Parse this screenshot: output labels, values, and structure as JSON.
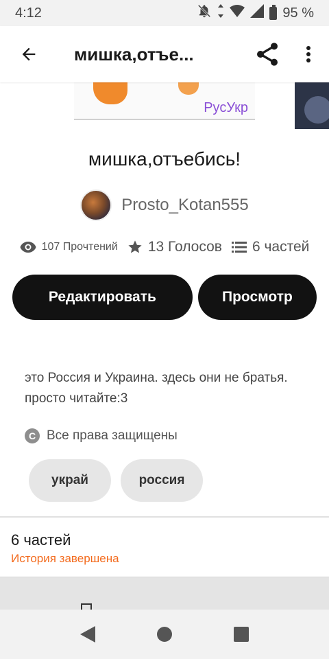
{
  "status_bar": {
    "time": "4:12",
    "battery": "95 %"
  },
  "app_bar": {
    "title": "мишка,отъе..."
  },
  "cover": {
    "text": "РусУкр"
  },
  "story": {
    "title": "мишка,отъебись!",
    "author": "Prosto_Kotan555",
    "reads": "107 Прочтений",
    "votes": "13 Голосов",
    "parts": "6 частей",
    "description": "это Россия и Украина. здесь они не братья. просто читайте:3",
    "copyright": "Все права защищены"
  },
  "actions": {
    "edit_label": "Редактировать",
    "view_label": "Просмотр"
  },
  "tags": [
    "украй",
    "россия"
  ],
  "parts_section": {
    "count": "6 частей",
    "status": "История завершена"
  },
  "colors": {
    "accent": "#f36a1c",
    "button_bg": "#121212"
  }
}
